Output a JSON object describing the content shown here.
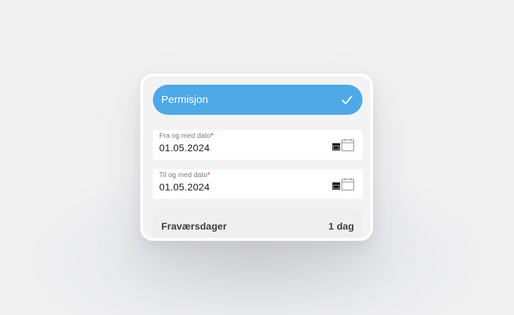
{
  "absence_type": {
    "selected": "Permisjon",
    "icon": "check-icon"
  },
  "from_date": {
    "label": "Fra og med dato",
    "required_mark": "*",
    "value": "01.05.2024",
    "icon": "calendar-icon"
  },
  "to_date": {
    "label": "Til og med dato",
    "required_mark": "*",
    "value": "01.05.2024",
    "icon": "calendar-icon"
  },
  "summary": {
    "label": "Fraværsdager",
    "value": "1 dag"
  },
  "colors": {
    "accent": "#4ea9e6",
    "required": "#e03030"
  }
}
